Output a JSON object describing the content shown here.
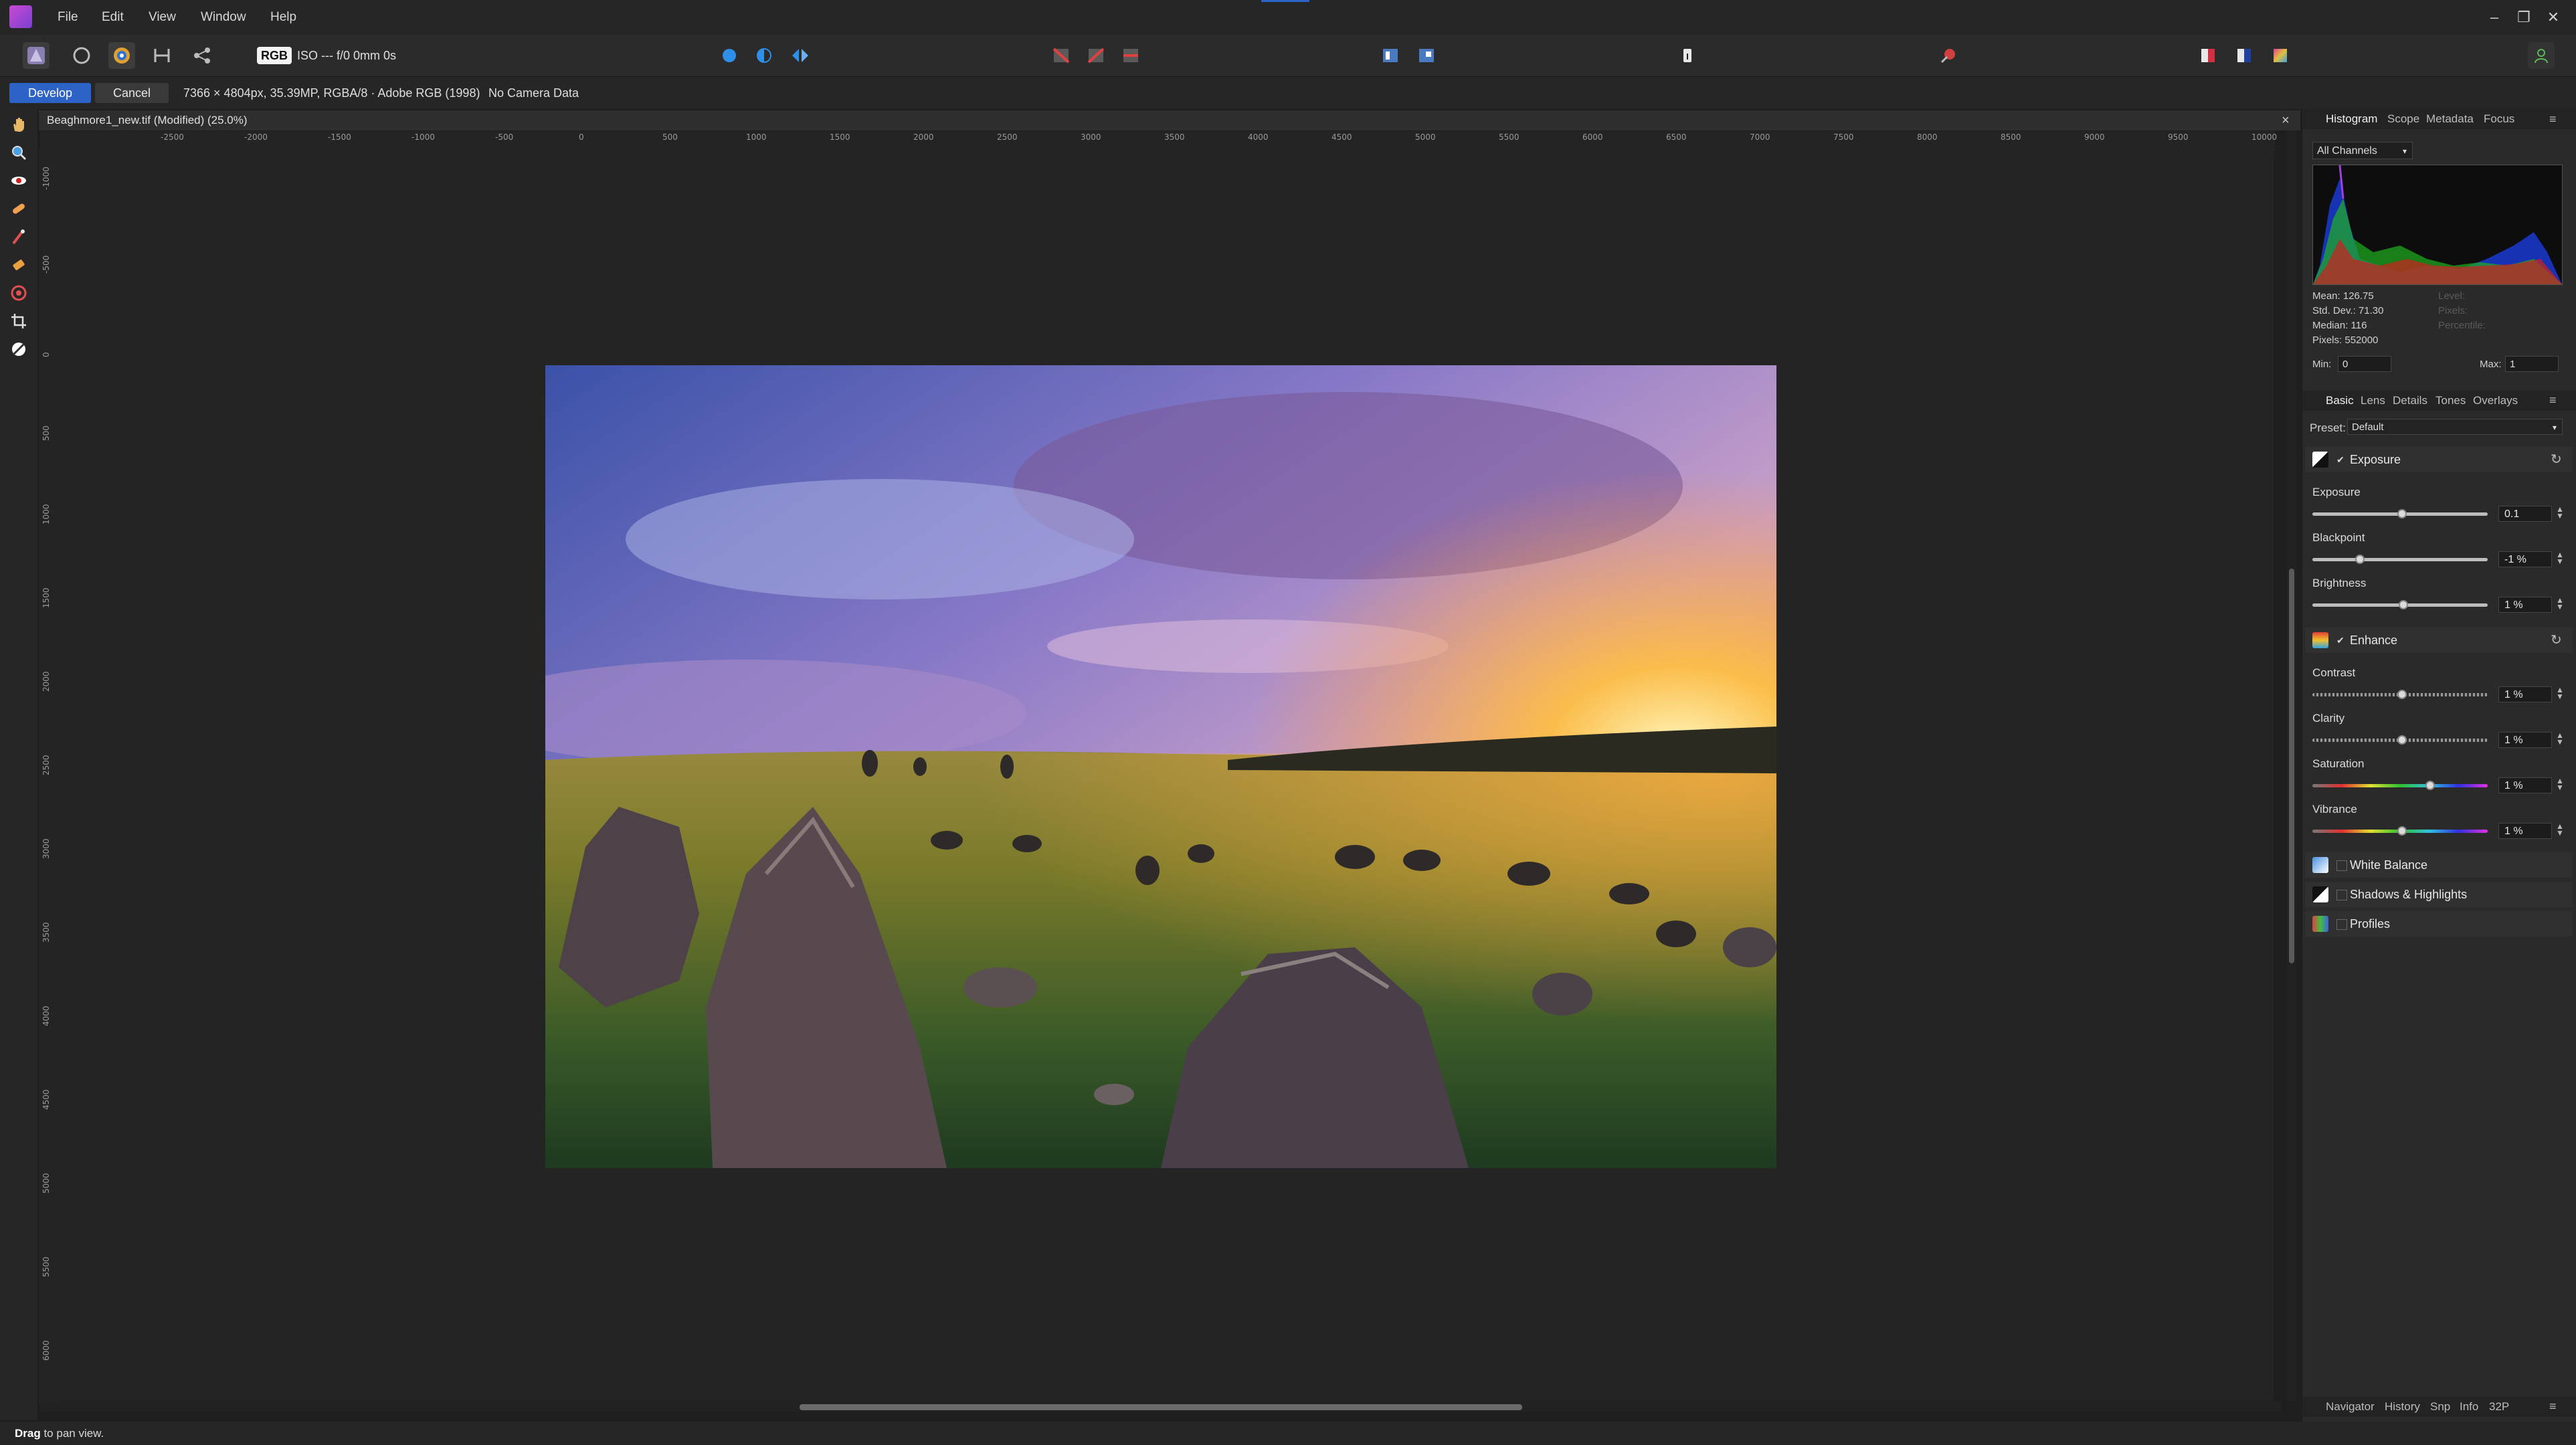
{
  "menu": {
    "items": [
      "File",
      "Edit",
      "View",
      "Window",
      "Help"
    ]
  },
  "toolbar": {
    "rgb_badge": "RGB",
    "camera_info": "ISO --- f/0 0mm 0s"
  },
  "context": {
    "develop_label": "Develop",
    "cancel_label": "Cancel",
    "doc_info": "7366 × 4804px, 35.39MP, RGBA/8 · Adobe RGB (1998)",
    "camera_data": "No Camera Data"
  },
  "document": {
    "title": "Beaghmore1_new.tif (Modified) (25.0%)",
    "close_glyph": "×"
  },
  "rulers": {
    "h_ticks": [
      "-2500",
      "-2000",
      "-1500",
      "-1000",
      "-500",
      "0",
      "500",
      "1000",
      "1500",
      "2000",
      "2500",
      "3000",
      "3500",
      "4000",
      "4500",
      "5000",
      "5500",
      "6000",
      "6500",
      "7000",
      "7500",
      "8000",
      "8500",
      "9000",
      "9500",
      "10000"
    ],
    "v_ticks": [
      "-1000",
      "-500",
      "0",
      "500",
      "1000",
      "1500",
      "2000",
      "2500",
      "3000",
      "3500",
      "4000",
      "4500",
      "5000",
      "5500",
      "6000"
    ]
  },
  "histogram_panel": {
    "tabs": [
      "Histogram",
      "Scope",
      "Metadata",
      "Focus"
    ],
    "active_tab": "Histogram",
    "channel": "All Channels",
    "stats": [
      "Mean: 126.75",
      "Std. Dev.: 71.30",
      "Median: 116",
      "Pixels: 552000"
    ],
    "stats_dim": [
      "Level:",
      "Pixels:",
      "Percentile:"
    ],
    "min_label": "Min:",
    "min_value": "0",
    "max_label": "Max:",
    "max_value": "1"
  },
  "develop_panel": {
    "tabs": [
      "Basic",
      "Lens",
      "Details",
      "Tones",
      "Overlays"
    ],
    "active_tab": "Basic",
    "preset_label": "Preset:",
    "preset_value": "Default",
    "sections": {
      "exposure": "Exposure",
      "enhance": "Enhance",
      "white_balance": "White Balance",
      "shadows_highlights": "Shadows & Highlights",
      "profiles": "Profiles"
    },
    "sliders": [
      {
        "label": "Exposure",
        "value": "0.1",
        "level": 0.51
      },
      {
        "label": "Blackpoint",
        "value": "-1 %",
        "level": 0.27
      },
      {
        "label": "Brightness",
        "value": "1 %",
        "level": 0.52
      },
      {
        "label": "Contrast",
        "value": "1 %",
        "level": 0.51
      },
      {
        "label": "Clarity",
        "value": "1 %",
        "level": 0.51
      },
      {
        "label": "Saturation",
        "value": "1 %",
        "level": 0.67
      },
      {
        "label": "Vibrance",
        "value": "1 %",
        "level": 0.51
      }
    ]
  },
  "bottom_tabs": [
    "Navigator",
    "History",
    "Snp",
    "Info",
    "32P"
  ],
  "status": {
    "bold": "Drag",
    "rest": " to pan view."
  },
  "window_controls": [
    "–",
    "❐",
    "✕"
  ]
}
